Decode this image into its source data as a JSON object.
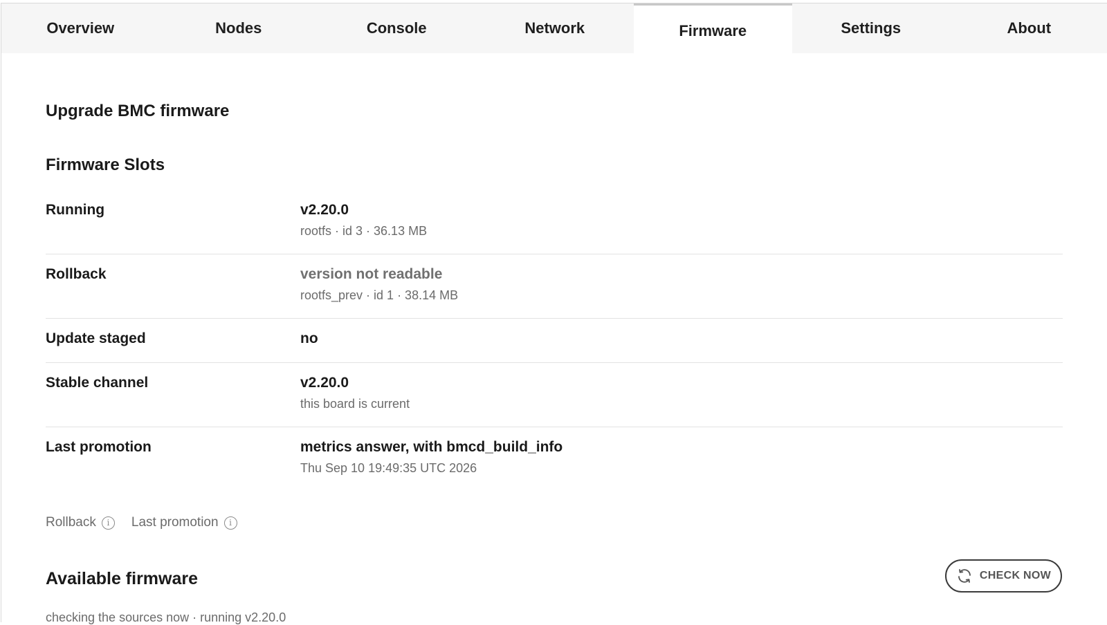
{
  "tabs": [
    {
      "label": "Overview",
      "active": false
    },
    {
      "label": "Nodes",
      "active": false
    },
    {
      "label": "Console",
      "active": false
    },
    {
      "label": "Network",
      "active": false
    },
    {
      "label": "Firmware",
      "active": true
    },
    {
      "label": "Settings",
      "active": false
    },
    {
      "label": "About",
      "active": false
    }
  ],
  "page": {
    "title": "Upgrade BMC firmware",
    "slots_heading": "Firmware Slots"
  },
  "slots": [
    {
      "label": "Running",
      "primary": "v2.20.0",
      "secondary": "rootfs · id 3 · 36.13 MB"
    },
    {
      "label": "Rollback",
      "primary": "version not readable",
      "secondary": "rootfs_prev · id 1 · 38.14 MB"
    },
    {
      "label": "Update staged",
      "primary": "no"
    },
    {
      "label": "Stable channel",
      "primary": "v2.20.0",
      "secondary": "this board is current"
    },
    {
      "label": "Last promotion",
      "primary": "metrics answer, with bmcd_build_info",
      "secondary": "Thu Sep 10 19:49:35 UTC 2026"
    }
  ],
  "help_links": [
    {
      "label": "Rollback",
      "icon": "info-icon"
    },
    {
      "label": "Last promotion",
      "icon": "info-icon"
    }
  ],
  "available": {
    "heading": "Available firmware",
    "check_button_label": "CHECK NOW",
    "check_button_icon": "refresh-icon",
    "status": "checking the sources now · running v2.20.0"
  },
  "colors": {
    "tab_bar_bg": "#f6f6f6",
    "muted_text": "#6b6b6b",
    "divider": "#e2e2e2"
  }
}
